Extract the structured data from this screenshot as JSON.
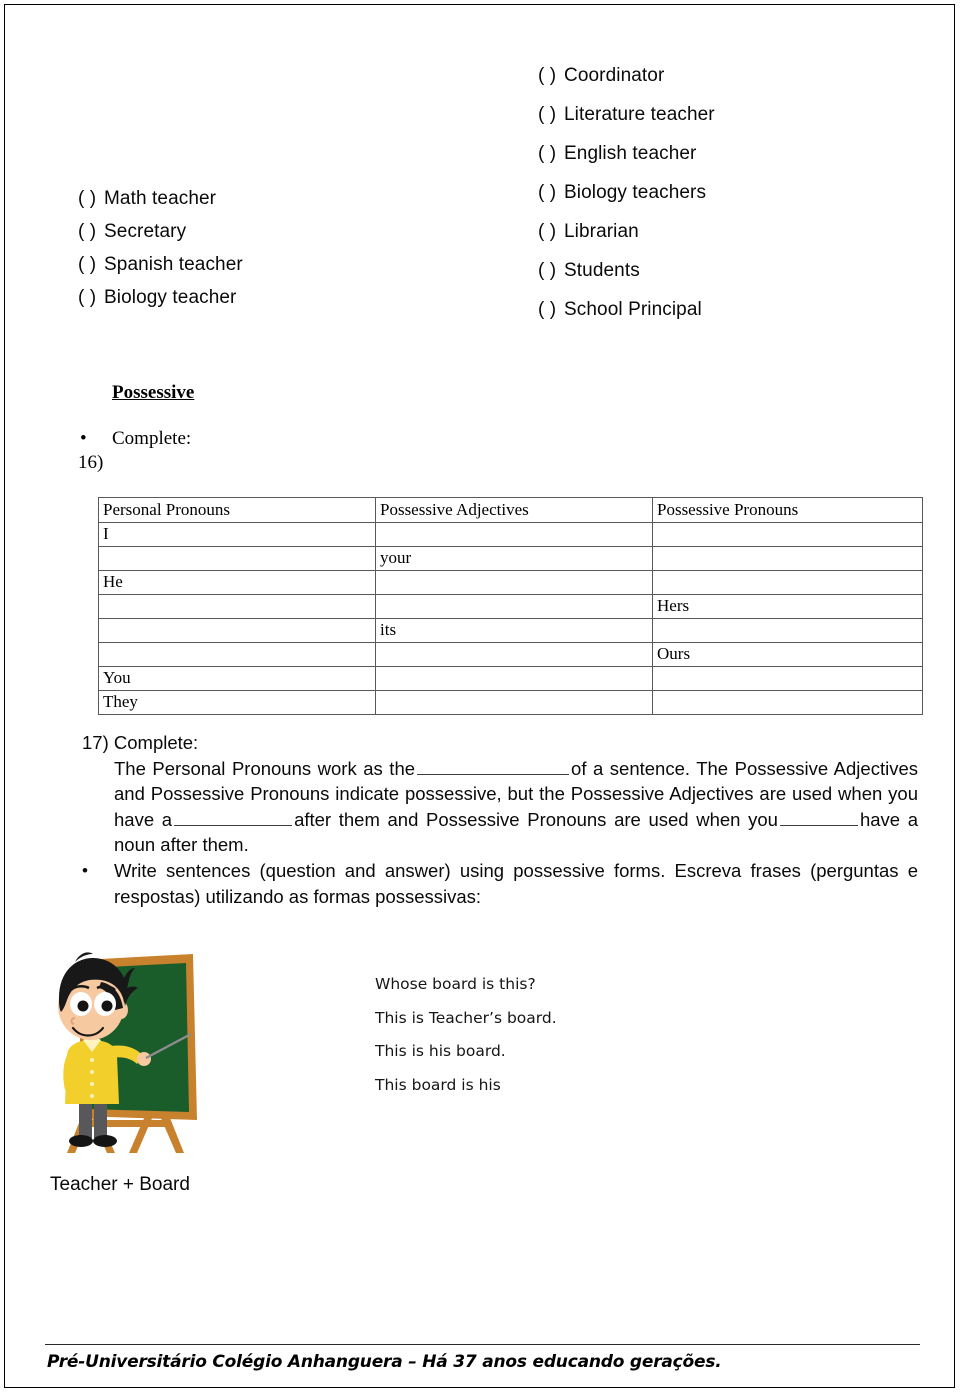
{
  "options_left": [
    {
      "box": "(  )",
      "label": "Math teacher"
    },
    {
      "box": "(  )",
      "label": "Secretary"
    },
    {
      "box": "(  )",
      "label": "Spanish teacher"
    },
    {
      "box": "(  )",
      "label": "Biology teacher"
    }
  ],
  "options_right": [
    {
      "box": "(  )",
      "label": "Coordinator"
    },
    {
      "box": "(  )",
      "label": "Literature teacher"
    },
    {
      "box": "(  )",
      "label": "English teacher"
    },
    {
      "box": "(  )",
      "label": "Biology teachers"
    },
    {
      "box": "(  )",
      "label": "Librarian"
    },
    {
      "box": "(  )",
      "label": "Students"
    },
    {
      "box": "(  )",
      "label": "School Principal"
    }
  ],
  "possessive": {
    "heading": "Possessive",
    "bullet_glyph": "•",
    "complete_label": "Complete:",
    "item_number": "16)"
  },
  "table": {
    "headers": [
      "Personal Pronouns",
      "Possessive Adjectives",
      "Possessive Pronouns"
    ],
    "rows": [
      [
        "I",
        "",
        ""
      ],
      [
        "",
        "your",
        ""
      ],
      [
        "He",
        "",
        ""
      ],
      [
        "",
        "",
        "Hers"
      ],
      [
        "",
        "its",
        ""
      ],
      [
        "",
        "",
        "Ours"
      ],
      [
        "You",
        "",
        ""
      ],
      [
        "They",
        "",
        ""
      ]
    ]
  },
  "item17": {
    "label": "17) Complete:",
    "t1": "The Personal Pronouns work as the",
    "t2": "of a sentence. The Possessive Adjectives and Possessive Pronouns indicate possessive, but the Possessive Adjectives are used when you have a",
    "t3": "after them and Possessive Pronouns are used when you",
    "t4": "have a noun after them."
  },
  "write_sentences": {
    "bullet_glyph": "•",
    "text": "Write sentences (question and answer) using possessive forms. Escreva frases (perguntas e respostas) utilizando as formas possessivas:"
  },
  "example_sentences": [
    "Whose board is this?",
    "This is Teacher’s board.",
    "This is his board.",
    "This board is his"
  ],
  "caption": "Teacher + Board",
  "footer": {
    "text": "Pré-Universitário Colégio Anhanguera – Há 37 anos educando gerações."
  },
  "colors": {
    "board_green": "#1b5c2b",
    "board_frame": "#c8822e",
    "jacket_yellow": "#f3cf2b",
    "skin": "#f6c9a0",
    "hair_black": "#181818",
    "pants_gray": "#58585a",
    "table_border": "#595959"
  }
}
